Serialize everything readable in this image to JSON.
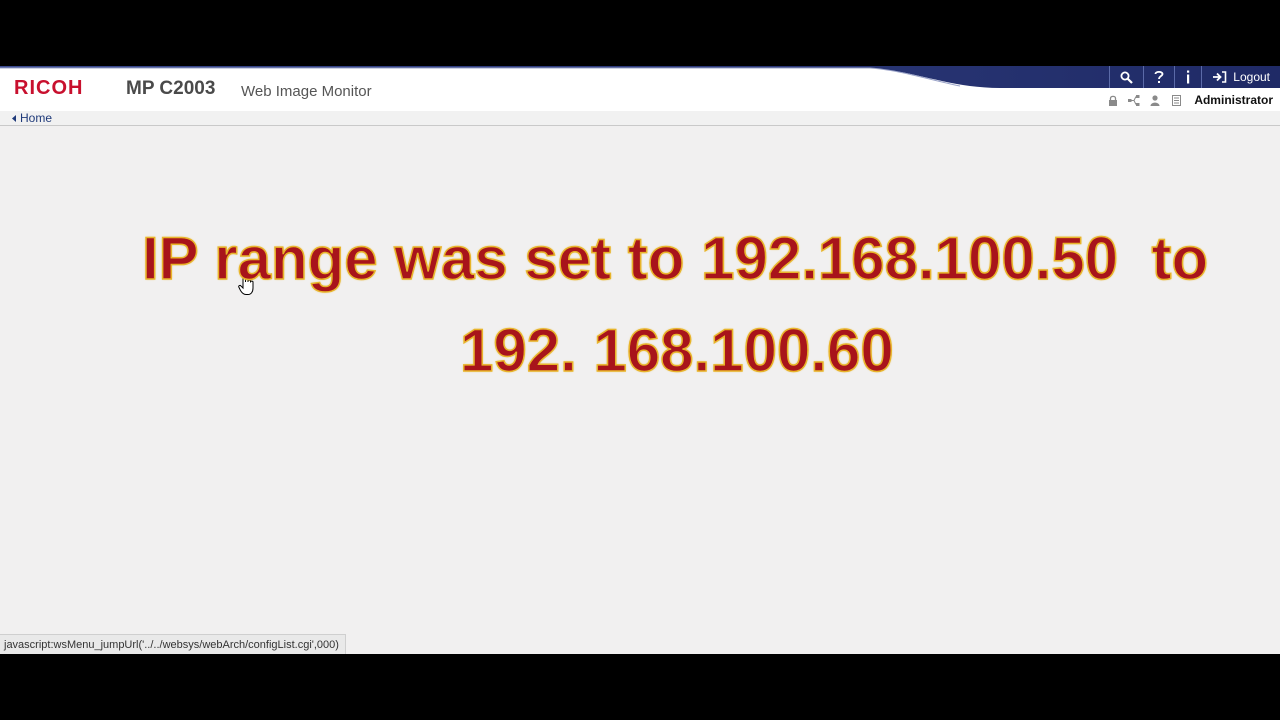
{
  "header": {
    "brand": "RICOH",
    "model": "MP C2003",
    "app_title": "Web Image Monitor",
    "nav": [
      {
        "icon": "search-icon"
      },
      {
        "icon": "help-icon"
      },
      {
        "icon": "info-icon"
      },
      {
        "icon": "logout-icon",
        "label": "Logout"
      }
    ],
    "status_icons": [
      "lock-icon",
      "network-icon",
      "user-icon",
      "document-icon"
    ],
    "user_role": "Administrator"
  },
  "breadcrumb": {
    "home_label": "Home"
  },
  "overlay": {
    "line1": "IP range was set to 192.168.100.50  to",
    "line2": "192. 168.100.60"
  },
  "statusbar": {
    "url": "javascript:wsMenu_jumpUrl('../../websys/webArch/configList.cgi',000)"
  },
  "colors": {
    "brand_red": "#c8102e",
    "header_navy": "#2c3a7a",
    "overlay_text": "#a8141b",
    "overlay_outline": "#e8b42a",
    "link_blue": "#1f3a7a",
    "page_background": "#f1f0f0"
  }
}
